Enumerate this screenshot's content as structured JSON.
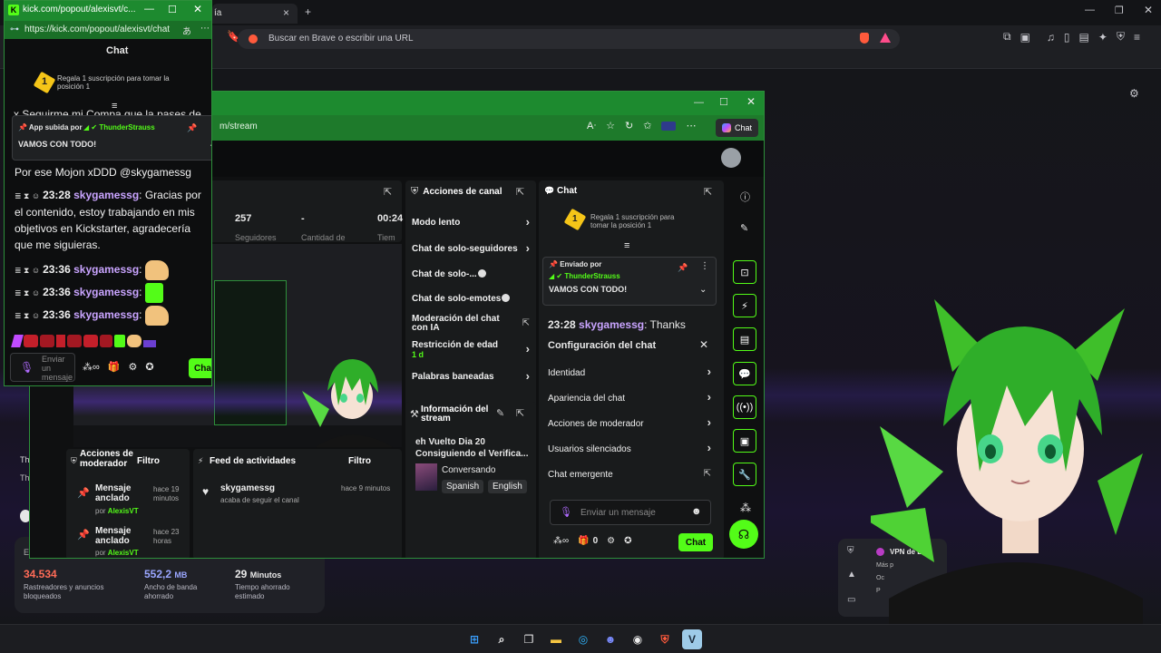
{
  "brave": {
    "tab_title": "ía",
    "new_tab": "+",
    "url_placeholder": "Buscar en Brave o escribir una URL",
    "stats": [
      {
        "value": "34.534",
        "label": "Rastreadores y anuncios bloqueados",
        "color": "#ff6b57"
      },
      {
        "value": "552,2",
        "unit": "MB",
        "label": "Ancho de banda ahorrado",
        "color": "#9aa6ff"
      },
      {
        "value": "29",
        "unit": "Minutos",
        "label": "Tiempo ahorrado estimado",
        "color": "#ffffff"
      }
    ],
    "vpn": {
      "title": "VPN de B",
      "items": [
        "Más p",
        "Oc",
        "P"
      ]
    },
    "side_fragments": [
      "Th",
      "Th"
    ],
    "stats_prefix": "E"
  },
  "popout": {
    "title": "kick.com/popout/alexisvt/c...",
    "url": "https://kick.com/popout/alexisvt/chat",
    "header": "Chat",
    "gift_text": "Regala 1 suscripción para tomar la posición 1",
    "gift_rank": "1",
    "overflow_line": "x Seguirme mi Compa que la pases de",
    "pinned": {
      "by_label": "App subida por",
      "user": "ThunderStrauss",
      "message": "VAMOS CON TODO!"
    },
    "messages": [
      {
        "text": "Por ese Mojon xDDD @skygamessg",
        "plain": true
      },
      {
        "time": "23:28",
        "user": "skygamessg",
        "text": "Gracias por el contenido, estoy trabajando en mis objetivos en Kickstarter, agradecería que me siguieras."
      },
      {
        "time": "23:36",
        "user": "skygamessg",
        "text": ":",
        "emote": "#f1c27d"
      },
      {
        "time": "23:36",
        "user": "skygamessg",
        "text": ":",
        "emote": "#53fc18"
      },
      {
        "time": "23:36",
        "user": "skygamessg",
        "text": ":",
        "emote": "#f1c27d"
      }
    ],
    "input_placeholder": "Enviar un mensaje",
    "chat_button": "Chat"
  },
  "edge": {
    "url_fragment": "m/stream",
    "chat_button": "Chat",
    "stats_row": {
      "val1": "257",
      "lbl1": "Seguidores",
      "val2": "-",
      "lbl2": "Cantidad de",
      "val3": "00:24",
      "lbl3": "Tiem"
    },
    "channel_actions": {
      "title": "Acciones de canal",
      "items": [
        {
          "label": "Modo lento",
          "control": "chevron"
        },
        {
          "label": "Chat de solo-seguidores",
          "control": "chevron"
        },
        {
          "label": "Chat de solo-...",
          "control": "toggle"
        },
        {
          "label": "Chat de solo-emotes",
          "control": "toggle"
        },
        {
          "label": "Moderación del chat con IA",
          "control": "external"
        },
        {
          "label": "Restricción de edad",
          "sub": "1 d",
          "control": "chevron"
        },
        {
          "label": "Palabras baneadas",
          "control": "chevron"
        }
      ]
    },
    "stream_info": {
      "title": "Información del stream",
      "stream_title": "eh Vuelto Dia 20 Consiguiendo el Verifica...",
      "category": "Conversando",
      "tags": [
        "Spanish",
        "English"
      ]
    },
    "mod_actions": {
      "title": "Acciones de moderador",
      "filter": "Filtro",
      "items": [
        {
          "label": "Mensaje anclado",
          "time": "hace 19 minutos",
          "by": "por",
          "user": "AlexisVT"
        },
        {
          "label": "Mensaje anclado",
          "time": "hace 23 horas",
          "by": "por",
          "user": "AlexisVT"
        }
      ]
    },
    "activity": {
      "title": "Feed de actividades",
      "filter": "Filtro",
      "items": [
        {
          "user": "skygamessg",
          "action": "acaba de seguir el canal",
          "time": "hace 9 minutos"
        }
      ]
    },
    "chat": {
      "title": "Chat",
      "gift_text": "Regala 1 suscripción para tomar la posición 1",
      "gift_rank": "1",
      "pinned": {
        "by_label": "Enviado por",
        "user": "ThunderStrauss",
        "message": "VAMOS CON TODO!"
      },
      "visible_message": {
        "time": "23:28",
        "user": "skygamessg",
        "text": ": Thanks"
      },
      "settings": {
        "title": "Configuración del chat",
        "items": [
          {
            "label": "Identidad",
            "control": "chevron"
          },
          {
            "label": "Apariencia del chat",
            "control": "chevron"
          },
          {
            "label": "Acciones de moderador",
            "control": "chevron"
          },
          {
            "label": "Usuarios silenciados",
            "control": "chevron"
          },
          {
            "label": "Chat emergente",
            "control": "external"
          }
        ]
      },
      "input_placeholder": "Enviar un mensaje",
      "count": "0",
      "send_button": "Chat"
    }
  },
  "colors": {
    "kick_green": "#53fc18",
    "username": "#c9a4ff",
    "edge_frame": "#1d8a2f"
  }
}
